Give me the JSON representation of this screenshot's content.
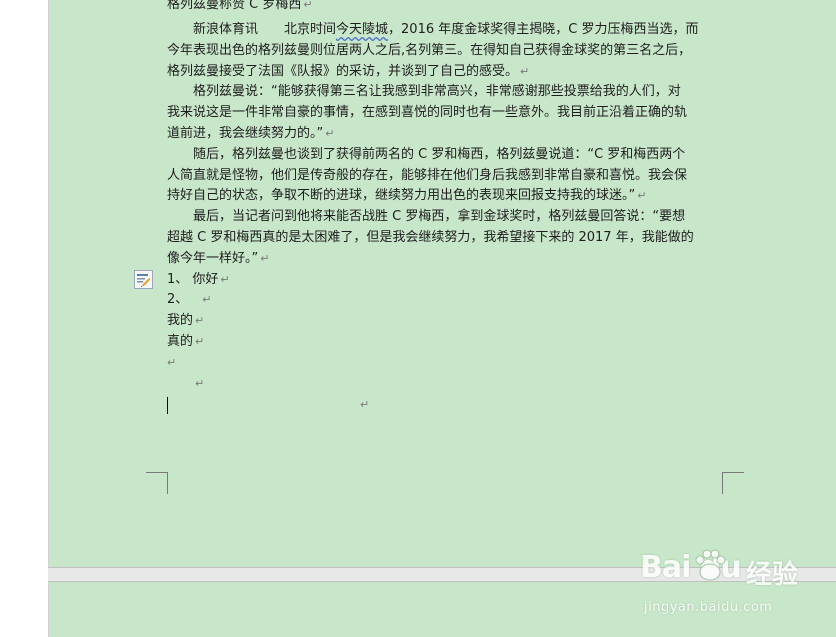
{
  "document": {
    "partial_top_line": "格列兹曼称赞 C 罗梅西",
    "paragraphs": [
      {
        "lines": [
          "新浪体育讯　　北京时间今天陵城，2016 年度金球奖得主揭晓，C 罗力压梅西当选，而",
          "今年表现出色的格列兹曼则位居两人之后,名列第三。在得知自己获得金球奖的第三名之后，",
          "格列兹曼接受了法国《队报》的采访，并谈到了自己的感受。"
        ]
      },
      {
        "lines": [
          "格列兹曼说：“能够获得第三名让我感到非常高兴，非常感谢那些投票给我的人们，对",
          "我来说这是一件非常自豪的事情，在感到喜悦的同时也有一些意外。我目前正沿着正确的轨",
          "道前进，我会继续努力的。”"
        ]
      },
      {
        "lines": [
          "随后，格列兹曼也谈到了获得前两名的 C 罗和梅西，格列兹曼说道：“C 罗和梅西两个",
          "人简直就是怪物，他们是传奇般的存在，能够排在他们身后我感到非常自豪和喜悦。我会保",
          "持好自己的状态，争取不断的进球，继续努力用出色的表现来回报支持我的球迷。”"
        ]
      },
      {
        "lines": [
          "最后，当记者问到他将来能否战胜 C 罗梅西，拿到金球奖时，格列兹曼回答说：“要想",
          "超越 C 罗和梅西真的是太困难了，但是我会继续努力，我希望接下来的 2017 年，我能做的",
          "像今年一样好。”"
        ]
      }
    ],
    "list_items": [
      "1、 你好",
      "2、",
      "我的",
      "真的"
    ],
    "paragraph_mark": "↵"
  },
  "watermark": {
    "logo": "Bai du",
    "cn": "经验",
    "url": "jingyan.baidu.com"
  },
  "colors": {
    "page_background": "#c8e6c9",
    "page_gap": "#e8e8e8",
    "spellcheck_underline": "#4a70c9"
  },
  "icons": [
    "smart-tag-icon"
  ]
}
